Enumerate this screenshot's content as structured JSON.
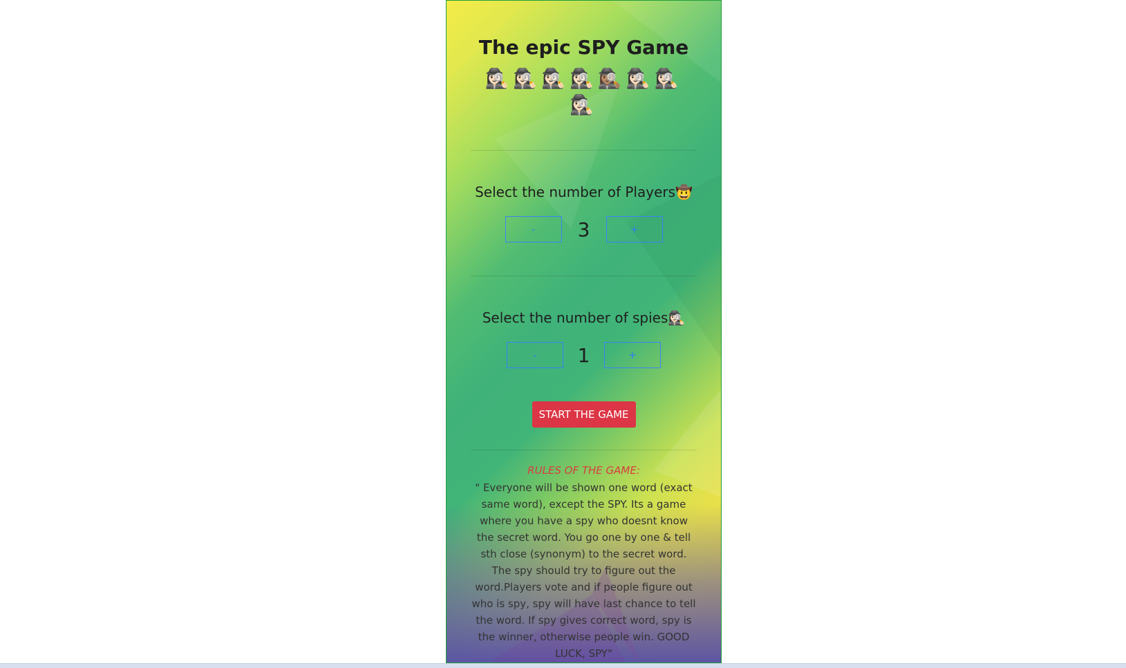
{
  "game": {
    "title": "The epic SPY Game",
    "spy_emojis": "🕵🏻‍♀️🕵🏻‍♀️🕵🏻‍♀️🕵🏻‍♀️🕵🏽‍♀️🕵🏻‍♀️🕵🏻‍♀️ 🕵🏻‍♀️"
  },
  "players": {
    "label": "Select the number of Players🤠",
    "minus_label": "-",
    "plus_label": "+",
    "count": "3"
  },
  "spies": {
    "label": "Select the number of spies🕵🏻‍♀️",
    "minus_label": "-",
    "plus_label": "+",
    "count": "1"
  },
  "actions": {
    "start_label": "START THE GAME"
  },
  "rules": {
    "title": "RULES OF THE GAME:",
    "text": "\" Everyone will be shown one word (exact same word), except the SPY. Its a game where you have a spy who doesnt know the secret word. You go one by one & tell sth close (synonym) to the secret word. The spy should try to figure out the word.Players vote and if people figure out who is spy, spy will have last chance to tell the word. If spy gives correct word, spy is the winner, otherwise people win. GOOD LUCK, SPY\""
  },
  "colors": {
    "border": "#1f9d3a",
    "button_outline": "#3b82f6",
    "start_button": "#dc3545",
    "rules_title": "#d93e3e"
  }
}
